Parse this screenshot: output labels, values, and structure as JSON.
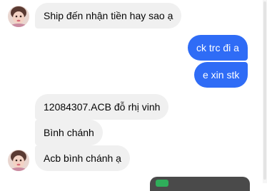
{
  "messages": {
    "m1": "Ship đến nhận tiền hay sao ạ",
    "m2": "ck trc đi a",
    "m3": "e xin stk",
    "m4": "12084307.ACB đỗ rhị vinh",
    "m5": "Bình chánh",
    "m6": "Acb bình chánh ạ"
  },
  "colors": {
    "incoming_bubble": "#f0f0f0",
    "outgoing_bubble": "#2f6cf6"
  }
}
